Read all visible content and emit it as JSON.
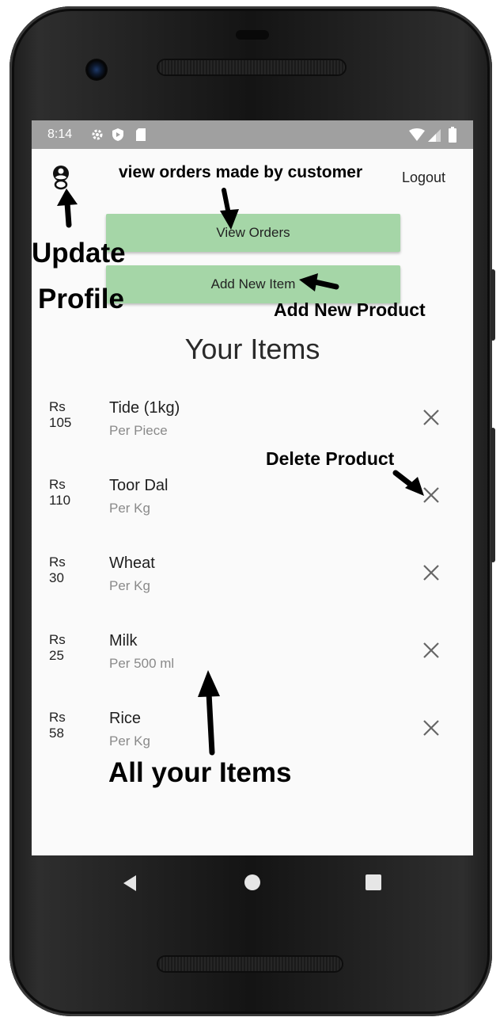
{
  "status_bar": {
    "time": "8:14"
  },
  "app_bar": {
    "logout_label": "Logout"
  },
  "buttons": {
    "view_orders": "View Orders",
    "add_new_item": "Add New Item"
  },
  "page_title": "Your Items",
  "items": [
    {
      "currency": "Rs",
      "price": "105",
      "name": "Tide (1kg)",
      "unit": "Per Piece"
    },
    {
      "currency": "Rs",
      "price": "110",
      "name": "Toor Dal",
      "unit": "Per Kg"
    },
    {
      "currency": "Rs",
      "price": "30",
      "name": "Wheat",
      "unit": "Per Kg"
    },
    {
      "currency": "Rs",
      "price": "25",
      "name": "Milk",
      "unit": "Per 500 ml"
    },
    {
      "currency": "Rs",
      "price": "58",
      "name": "Rice",
      "unit": "Per Kg"
    }
  ],
  "annotations": {
    "view_orders_note": "view orders made by customer",
    "update_profile_line1": "Update",
    "update_profile_line2": "Profile",
    "add_new_product": "Add New Product",
    "delete_product": "Delete Product",
    "all_your_items": "All your Items"
  },
  "icons": {
    "profile": "account-circle-icon",
    "delete": "close-icon",
    "status": [
      "settings-icon",
      "shield-icon",
      "sd-card-icon",
      "wifi-icon",
      "signal-icon",
      "battery-icon"
    ],
    "nav": [
      "back-icon",
      "home-icon",
      "recents-icon"
    ]
  },
  "colors": {
    "button_bg": "#a5d6a7",
    "status_bar": "#a0a0a0",
    "screen_bg": "#fafafa"
  }
}
